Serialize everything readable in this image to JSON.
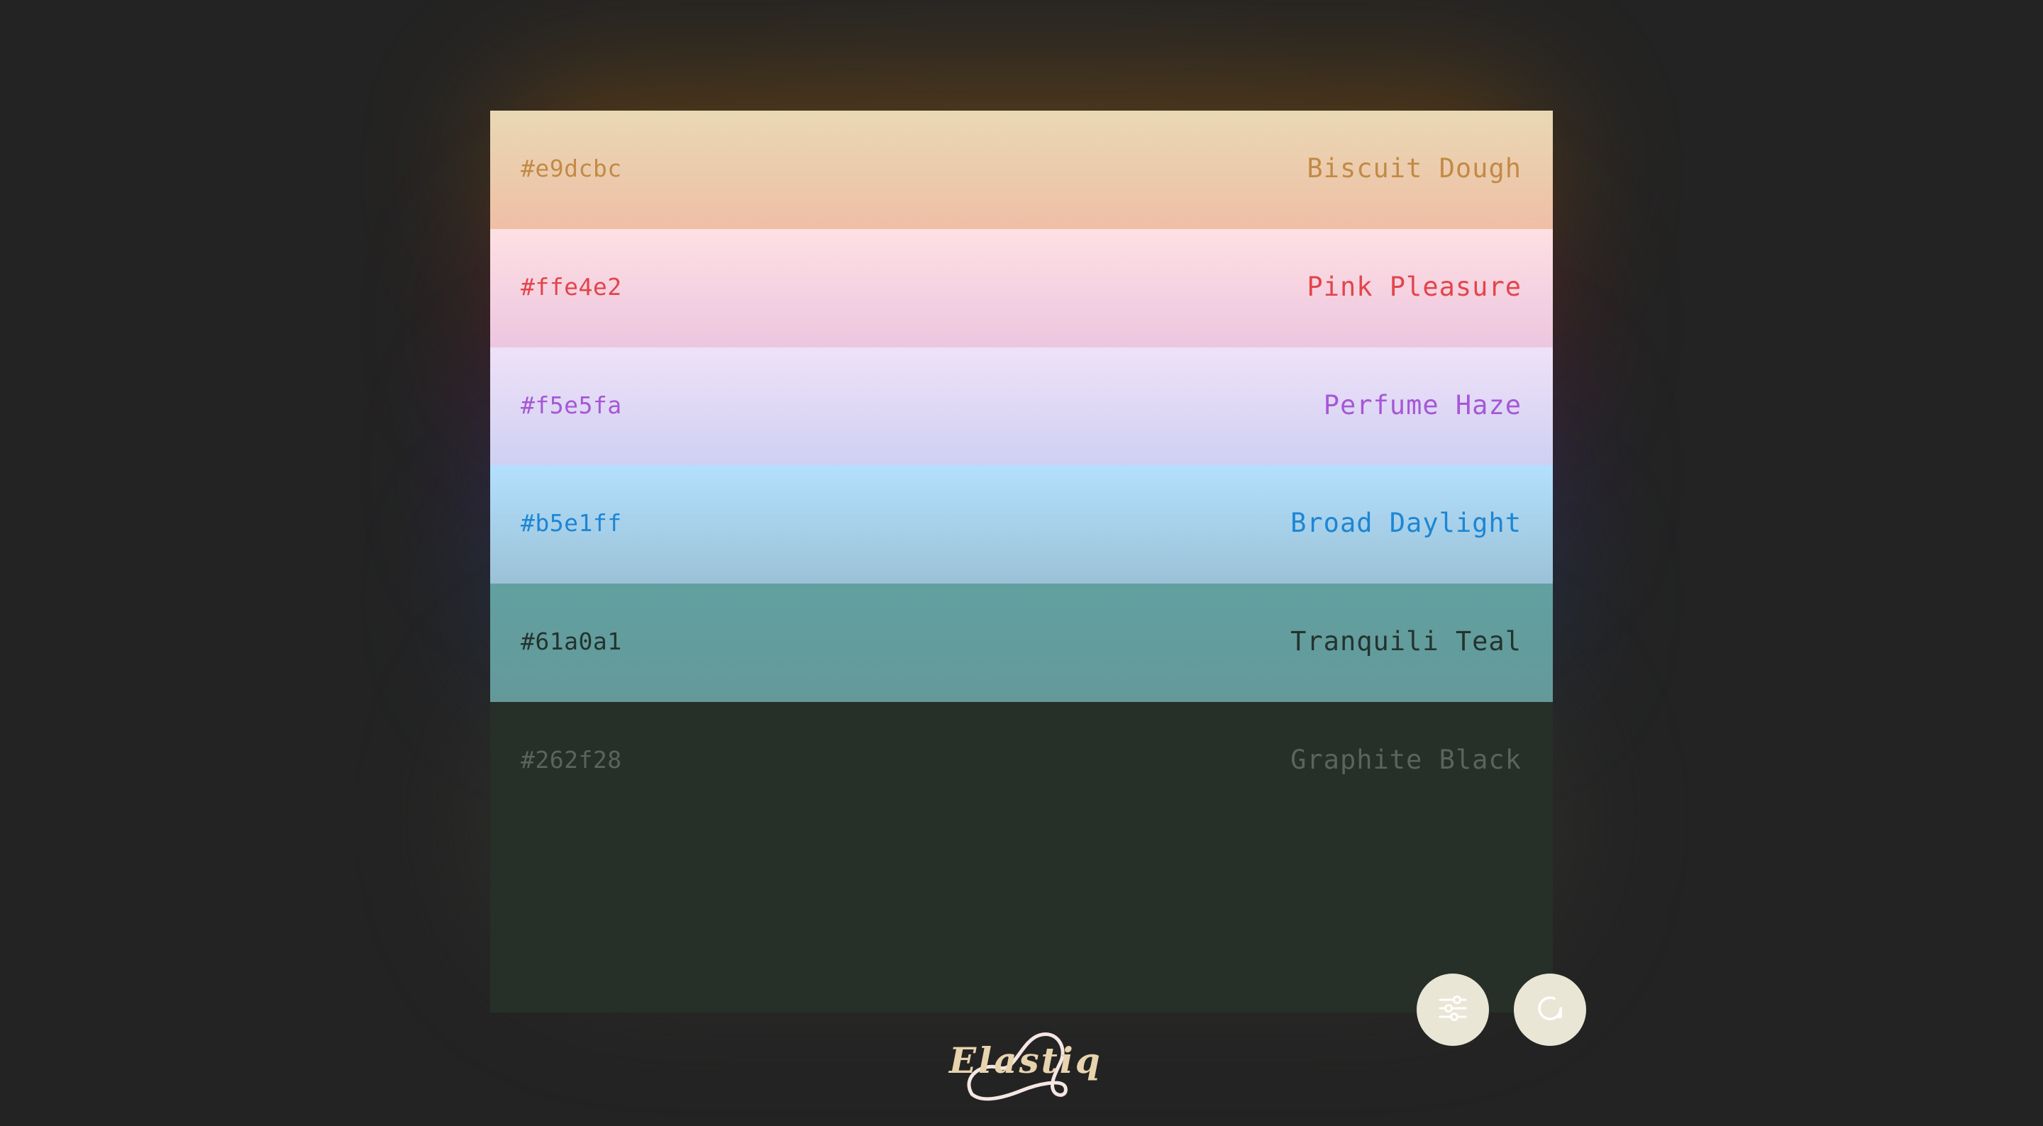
{
  "palette": {
    "swatches": [
      {
        "hex": "#e9dcbc",
        "name": "Biscuit Dough",
        "bg_top": "#e9d8b4",
        "bg_bottom": "#efbfa6",
        "text": "#c28a45",
        "glow": "#c57a2a"
      },
      {
        "hex": "#ffe4e2",
        "name": "Pink Pleasure",
        "bg_top": "#fee0e2",
        "bg_bottom": "#ecc6e0",
        "text": "#e4444b",
        "glow": "#c23a5e"
      },
      {
        "hex": "#f5e5fa",
        "name": "Perfume Haze",
        "bg_top": "#efe1f8",
        "bg_bottom": "#cfd0f2",
        "text": "#a757d6",
        "glow": "#7b4bc8"
      },
      {
        "hex": "#b5e1ff",
        "name": "Broad Daylight",
        "bg_top": "#b3e0fd",
        "bg_bottom": "#9bc1d7",
        "text": "#1d86d4",
        "glow": "#3d6ec2"
      },
      {
        "hex": "#61a0a1",
        "name": "Tranquili Teal",
        "bg_top": "#62a0a0",
        "bg_bottom": "#64999a",
        "text": "#24332f",
        "glow": "#3d6a6a"
      },
      {
        "hex": "#262f28",
        "name": "Graphite Black",
        "bg_top": "#262f28",
        "bg_bottom": "#262f28",
        "text": "#58655c",
        "glow": "#3a3a38"
      }
    ]
  },
  "controls": {
    "settings_icon": "sliders-icon",
    "refresh_icon": "refresh-icon"
  },
  "brand": {
    "logo_text": "Elastiq",
    "logo_color": "#e7d3ad",
    "swoosh_color": "#f5e6e3"
  }
}
